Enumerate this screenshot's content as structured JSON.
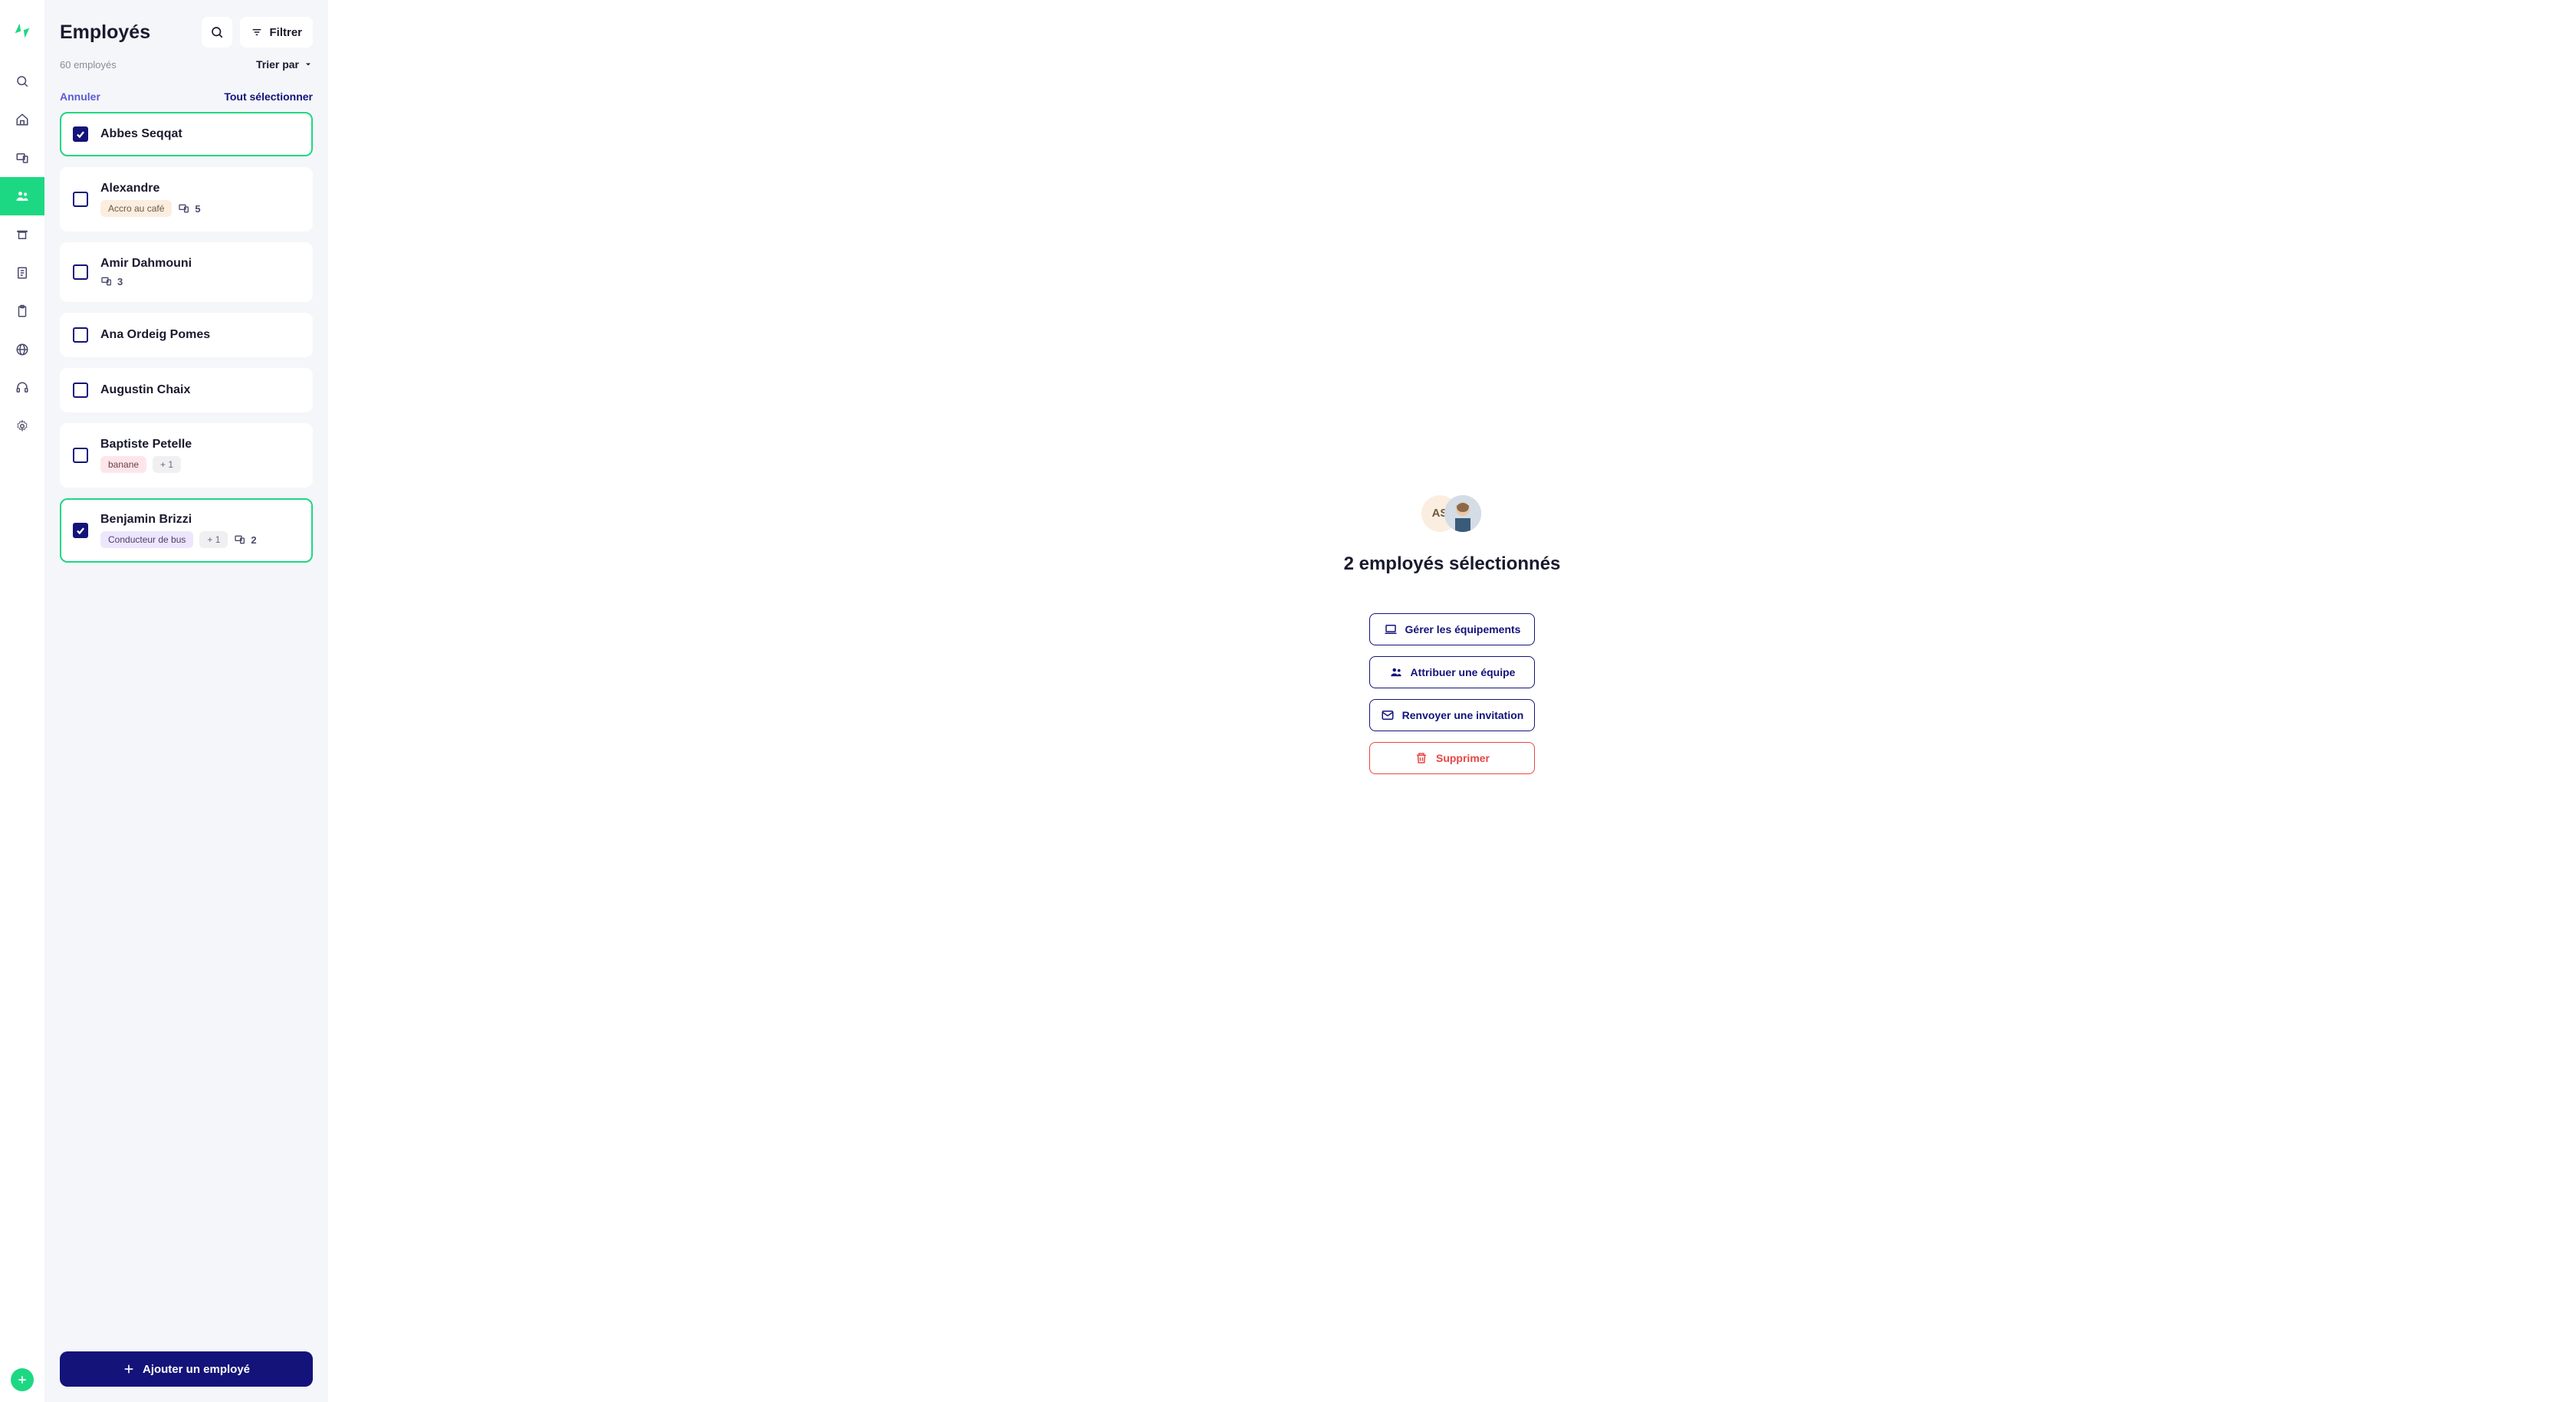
{
  "header": {
    "title": "Employés",
    "filter_label": "Filtrer",
    "count_text": "60 employés",
    "sort_label": "Trier par"
  },
  "selection_bar": {
    "cancel": "Annuler",
    "select_all": "Tout sélectionner"
  },
  "employees": [
    {
      "name": "Abbes Seqqat",
      "selected": true
    },
    {
      "name": "Alexandre",
      "selected": false,
      "tag": "Accro au café",
      "tag_class": "tag-orange",
      "devices": "5"
    },
    {
      "name": "Amir Dahmouni",
      "selected": false,
      "devices": "3"
    },
    {
      "name": "Ana Ordeig Pomes",
      "selected": false
    },
    {
      "name": "Augustin Chaix",
      "selected": false
    },
    {
      "name": "Baptiste Petelle",
      "selected": false,
      "tag": "banane",
      "tag_class": "tag-pink",
      "extra": "+ 1"
    },
    {
      "name": "Benjamin Brizzi",
      "selected": true,
      "tag": "Conducteur de bus",
      "tag_class": "tag-purple",
      "extra": "+ 1",
      "devices": "2"
    }
  ],
  "add_button": "Ajouter un employé",
  "detail": {
    "avatar_initials": "AS",
    "title": "2 employés sélectionnés",
    "actions": {
      "manage": "Gérer les équipements",
      "assign": "Attribuer une équipe",
      "resend": "Renvoyer une invitation",
      "delete": "Supprimer"
    }
  }
}
